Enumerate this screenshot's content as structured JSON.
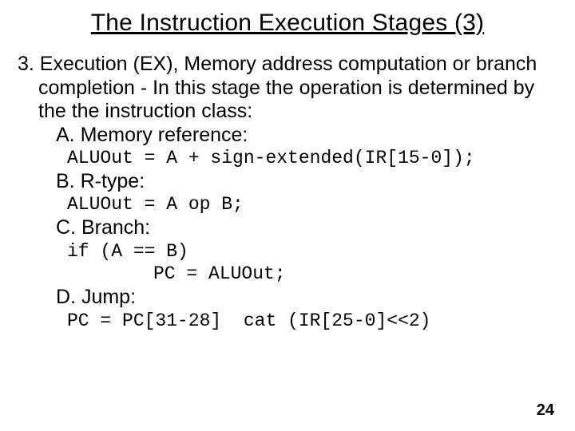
{
  "title": "The Instruction Execution Stages (3)",
  "intro": "3. Execution (EX), Memory address computation or branch completion - In this stage the operation is determined by the the instruction class:",
  "a_label": "A. Memory reference:",
  "a_code": "ALUOut = A + sign-extended(IR[15-0]);",
  "b_label": "B. R-type:",
  "b_code": "ALUOut = A op B;",
  "c_label": "C. Branch:",
  "c_code_line1": "if (A == B)",
  "c_code_line2": "PC = ALUOut;",
  "d_label": "D. Jump:",
  "d_code": "PC = PC[31-28]  cat (IR[25-0]<<2)",
  "page_number": "24"
}
